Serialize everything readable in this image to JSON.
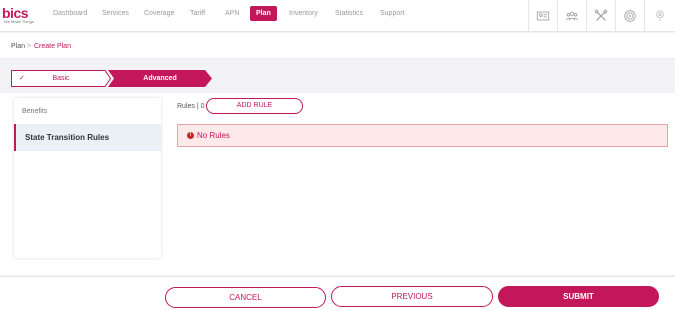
{
  "logo": {
    "main": "bics",
    "sub": "We Make Things"
  },
  "nav": {
    "items": [
      {
        "label": "Dashboard"
      },
      {
        "label": "Services"
      },
      {
        "label": "Coverage"
      },
      {
        "label": "Tariff"
      },
      {
        "label": "APN"
      },
      {
        "label": "Plan"
      },
      {
        "label": "Inventory"
      },
      {
        "label": "Statistics"
      },
      {
        "label": "Support"
      }
    ],
    "active": "Plan",
    "icons": [
      "id-card-icon",
      "users-icon",
      "tools-icon",
      "settings-badge-icon",
      "user-location-icon"
    ]
  },
  "breadcrumb": {
    "root": "Plan",
    "separator": ">",
    "current": "Create Plan"
  },
  "stepper": {
    "steps": [
      {
        "label": "Basic",
        "state": "completed",
        "check": "✓"
      },
      {
        "label": "Advanced",
        "state": "active"
      }
    ]
  },
  "sidebar": {
    "items": [
      {
        "label": "Benefits"
      },
      {
        "label": "State Transition Rules",
        "selected": true
      }
    ]
  },
  "rules": {
    "label": "Rules | 0",
    "add_button": "ADD RULE",
    "alert_icon": "!",
    "empty_message": "No Rules"
  },
  "footer": {
    "cancel": "CANCEL",
    "previous": "PREVIOUS",
    "submit": "SUBMIT"
  },
  "colors": {
    "accent": "#c2185b",
    "alert_bg": "#fde8ea",
    "selected_bg": "#e9f1f7"
  }
}
